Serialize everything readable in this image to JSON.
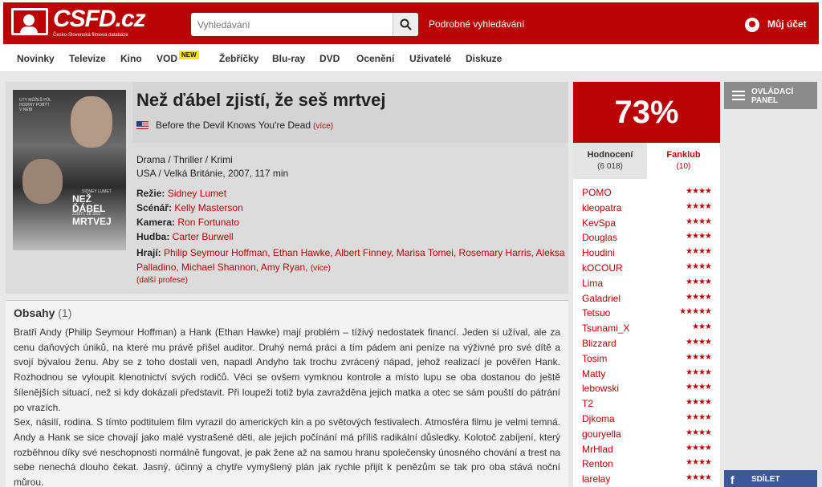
{
  "header": {
    "logo_text": "CSFD.cz",
    "logo_subtitle": "Česko-Slovenská filmová databáze",
    "search_placeholder": "Vyhledávání",
    "advanced_search": "Podrobné vyhledávání",
    "account": "Můj účet"
  },
  "nav": [
    {
      "label": "Novinky"
    },
    {
      "label": "Televize"
    },
    {
      "label": "Kino"
    },
    {
      "label": "VOD",
      "badge": "NEW"
    },
    {
      "label": "Žebříčky"
    },
    {
      "label": "Blu-ray"
    },
    {
      "label": "DVD"
    },
    {
      "label": "Ocenění"
    },
    {
      "label": "Uživatelé"
    },
    {
      "label": "Diskuze"
    }
  ],
  "poster": {
    "quote": "UTY MŮŽEŠ PŮL HODINY POBÝT V NEBI",
    "credit": "SIDNEY LUMET",
    "title_lines": [
      "NEŽ",
      "ĎÁBEL",
      "ZJISTÍ, ŽE SEŠ",
      "MRTVEJ"
    ]
  },
  "film": {
    "title": "Než ďábel zjistí, že seš mrtvej",
    "original_title": "Before the Devil Knows You're Dead",
    "original_more": "(více)",
    "genres": "Drama / Thriller / Krimi",
    "origin": "USA / Velká Británie, 2007, 117 min",
    "crew": [
      {
        "role": "Režie:",
        "names": "Sidney Lumet"
      },
      {
        "role": "Scénář:",
        "names": "Kelly Masterson"
      },
      {
        "role": "Kamera:",
        "names": "Ron Fortunato"
      },
      {
        "role": "Hudba:",
        "names": "Carter Burwell"
      }
    ],
    "cast_label": "Hrají:",
    "cast": "Philip Seymour Hoffman, Ethan Hawke, Albert Finney, Marisa Tomei, Rosemary Harris, Aleksa Palladino, Michael Shannon, Amy Ryan,",
    "cast_more": "(více)",
    "more_professions": "(další profese)"
  },
  "plot": {
    "heading": "Obsahy",
    "count": "(1)",
    "text": "Bratři Andy (Philip Seymour Hoffman) a Hank (Ethan Hawke) mají problém – tíživý nedostatek financí. Jeden si užíval, ale za cenu daňových úniků, na které mu právě přišel auditor. Druhý nemá práci a tím pádem ani peníze na výživné pro své dítě a svojí bývalou ženu. Aby se z toho dostali ven, napadl Andyho tak trochu zvrácený nápad, jehož realizací je pověřen Hank. Rozhodnou se vyloupit klenotnictví svých rodičů. Věci se ovšem vymknou kontrole a místo lupu se oba dostanou do ještě šílenějších situací, než si kdy dokázali představit. Při loupeži totiž byla zavražděna jejich matka a otec se sám pouští do pátrání po vrazích.",
    "text2": "Sex, násilí, rodina. S tímto podtitulem film vyrazil do amerických kin a po světových festivalech. Atmosféra filmu je velmi temná. Andy a Hank se sice chovají jako malé vystrašené děti, ale jejich počínání má příliš radikální důsledky. Kolotoč zabíjení, který rozběhnou díky své neschopnosti normálně fungovat, je pak žene až na samou hranu společensky únosného chování a trest na sebe nenechá dlouho čekat. Jasný, účinný a chytře vymyšlený plán jak rychle přijít k penězům se tak pro oba stává noční můrou."
  },
  "rating": {
    "percent": "73%",
    "tab_rating": "Hodnocení",
    "tab_rating_count": "(6 018)",
    "tab_fanclub": "Fanklub",
    "tab_fanclub_count": "(10)",
    "users": [
      {
        "name": "POMO",
        "stars": 4
      },
      {
        "name": "kleopatra",
        "stars": 4
      },
      {
        "name": "KevSpa",
        "stars": 4
      },
      {
        "name": "Douglas",
        "stars": 4
      },
      {
        "name": "Houdini",
        "stars": 4
      },
      {
        "name": "kOCOUR",
        "stars": 4
      },
      {
        "name": "Lima",
        "stars": 4
      },
      {
        "name": "Galadriel",
        "stars": 4
      },
      {
        "name": "Tetsuo",
        "stars": 5
      },
      {
        "name": "Tsunami_X",
        "stars": 3
      },
      {
        "name": "Blizzard",
        "stars": 4
      },
      {
        "name": "Tosim",
        "stars": 4
      },
      {
        "name": "Matty",
        "stars": 4
      },
      {
        "name": "lebowski",
        "stars": 4
      },
      {
        "name": "T2",
        "stars": 4
      },
      {
        "name": "Djkoma",
        "stars": 4
      },
      {
        "name": "gouryella",
        "stars": 4
      },
      {
        "name": "MrHlad",
        "stars": 4
      },
      {
        "name": "Renton",
        "stars": 4
      },
      {
        "name": "larelay",
        "stars": 4
      }
    ]
  },
  "sidebar": {
    "control_panel": "OVLÁDACÍ PANEL",
    "share": "SDÍLET",
    "share_icon": "f"
  }
}
